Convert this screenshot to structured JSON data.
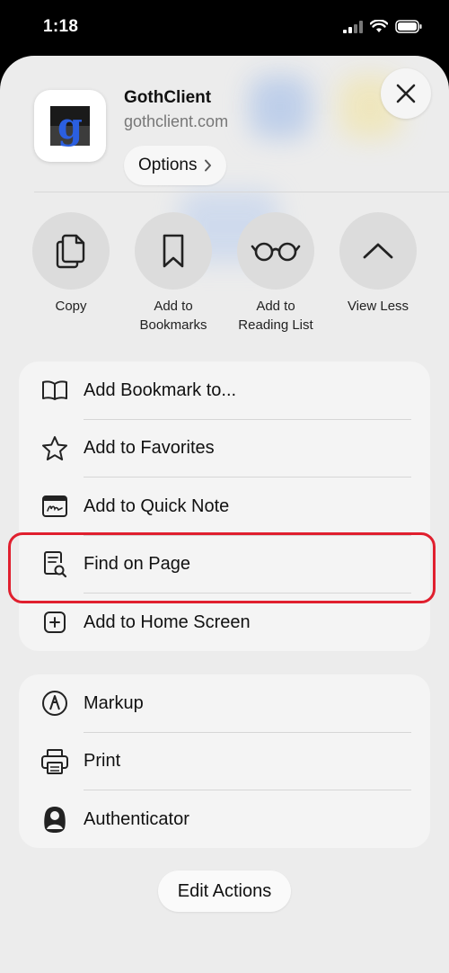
{
  "status_bar": {
    "time": "1:18"
  },
  "header": {
    "app_name": "GothClient",
    "url": "gothclient.com",
    "options_label": "Options",
    "logo_letter": "g"
  },
  "actions": [
    {
      "label": "Copy",
      "icon": "copy-icon"
    },
    {
      "label": "Add to Bookmarks",
      "icon": "bookmark-icon"
    },
    {
      "label": "Add to Reading List",
      "icon": "glasses-icon"
    },
    {
      "label": "View Less",
      "icon": "chevron-up-icon"
    }
  ],
  "menu_group_1": [
    {
      "label": "Add Bookmark to...",
      "icon": "book-icon"
    },
    {
      "label": "Add to Favorites",
      "icon": "star-icon"
    },
    {
      "label": "Add to Quick Note",
      "icon": "quick-note-icon"
    },
    {
      "label": "Find on Page",
      "icon": "find-on-page-icon"
    },
    {
      "label": "Add to Home Screen",
      "icon": "plus-square-icon"
    }
  ],
  "menu_group_2": [
    {
      "label": "Markup",
      "icon": "markup-icon"
    },
    {
      "label": "Print",
      "icon": "printer-icon"
    },
    {
      "label": "Authenticator",
      "icon": "authenticator-icon"
    }
  ],
  "edit_actions_label": "Edit Actions",
  "colors": {
    "highlight": "#e01f2e",
    "sheet": "#ececec"
  }
}
